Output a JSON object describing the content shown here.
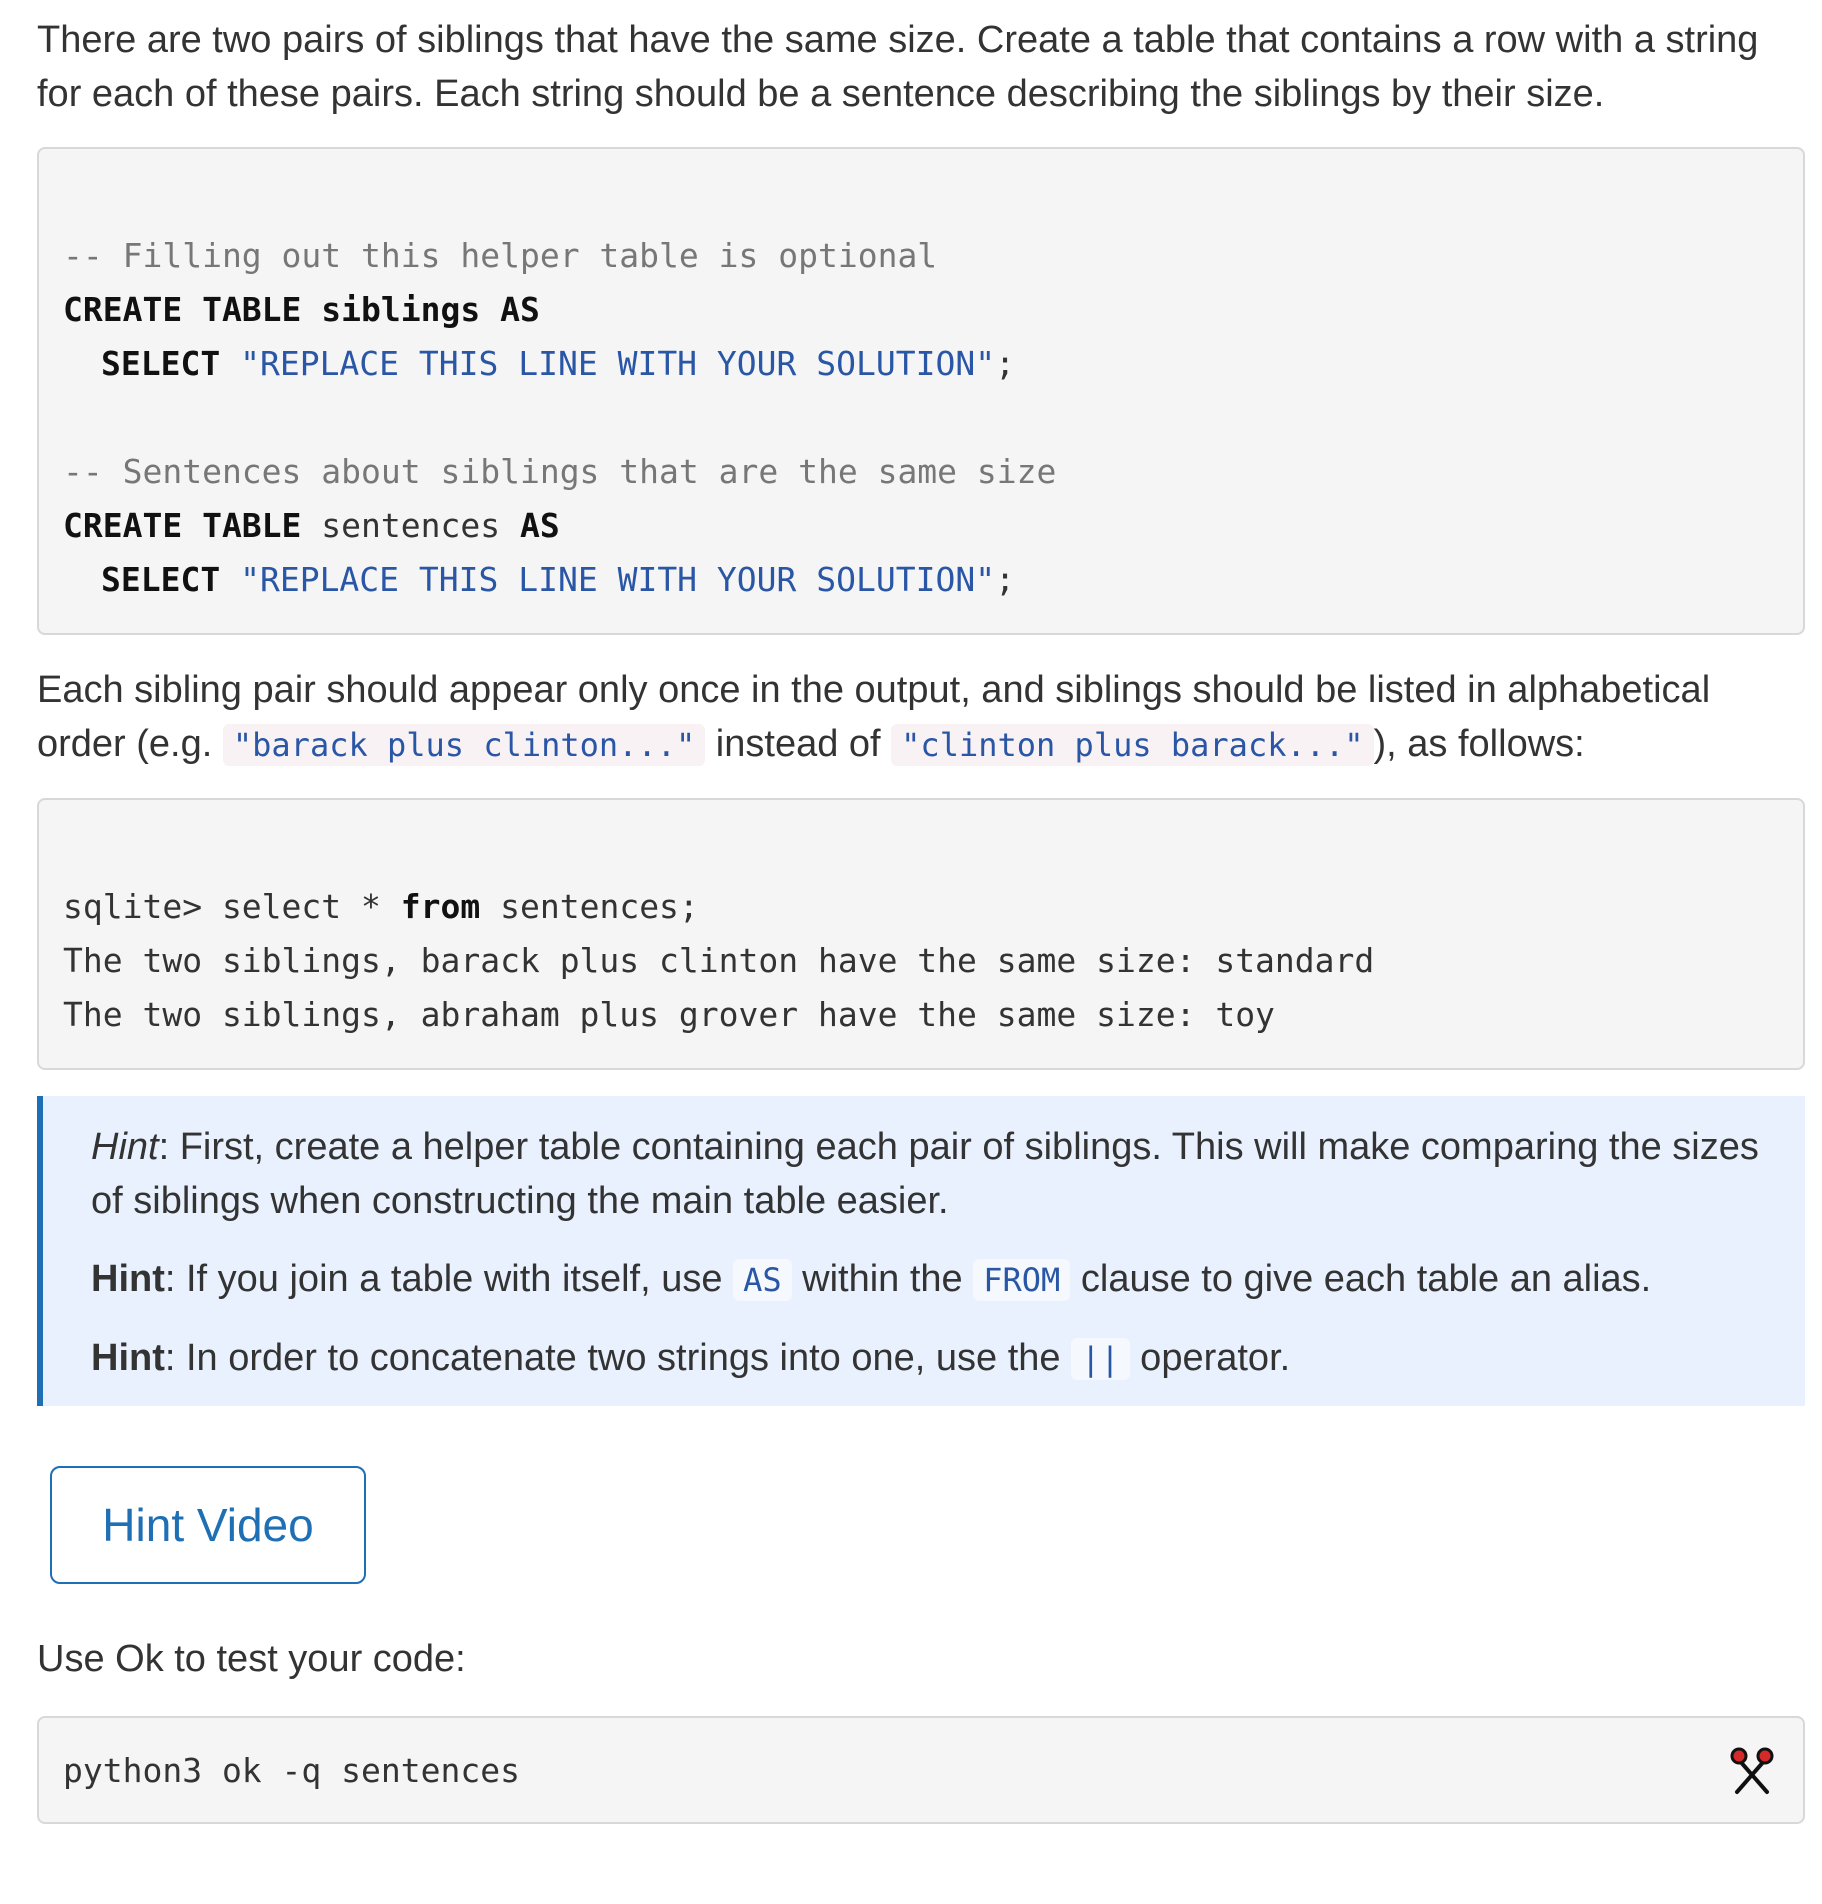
{
  "intro": "There are two pairs of siblings that have the same size. Create a table that contains a row with a string for each of these pairs. Each string should be a sentence describing the siblings by their size.",
  "code_block_1": {
    "comment1": "-- Filling out this helper table is optional",
    "kw_create": "CREATE TABLE",
    "table1": "siblings",
    "kw_as": "AS",
    "kw_select": "SELECT",
    "placeholder1": "\"REPLACE THIS LINE WITH YOUR SOLUTION\"",
    "semicolon": ";",
    "comment2": "-- Sentences about siblings that are the same size",
    "table2": "sentences",
    "placeholder2": "\"REPLACE THIS LINE WITH YOUR SOLUTION\""
  },
  "order_note": {
    "before": "Each sibling pair should appear only once in the output, and siblings should be listed in alphabetical order (e.g. ",
    "example1": "\"barack plus clinton...\"",
    "middle": " instead of ",
    "example2": "\"clinton plus barack...\"",
    "after": "), as follows:"
  },
  "code_block_2": {
    "prompt_before": "sqlite> select * ",
    "kw_from": "from",
    "prompt_after": " sentences;",
    "row1": "The two siblings, barack plus clinton have the same size: standard",
    "row2": "The two siblings, abraham plus grover have the same size: toy"
  },
  "hints": {
    "h1_label": "Hint",
    "h1_text": ": First, create a helper table containing each pair of siblings. This will make comparing the sizes of siblings when constructing the main table easier.",
    "h2_label": "Hint",
    "h2_before": ": If you join a table with itself, use ",
    "h2_code1": "AS",
    "h2_middle": " within the ",
    "h2_code2": "FROM",
    "h2_after": " clause to give each table an alias.",
    "h3_label": "Hint",
    "h3_before": ": In order to concatenate two strings into one, use the ",
    "h3_code": "||",
    "h3_after": " operator."
  },
  "hint_video_button": "Hint Video",
  "ok_instruction": "Use Ok to test your code:",
  "ok_command": "python3 ok -q sentences",
  "icons": {
    "copy": "scissors-icon"
  },
  "colors": {
    "accent": "#1f6fb5",
    "code_string": "#2a56a6",
    "hint_bg": "#e8f1fd"
  }
}
